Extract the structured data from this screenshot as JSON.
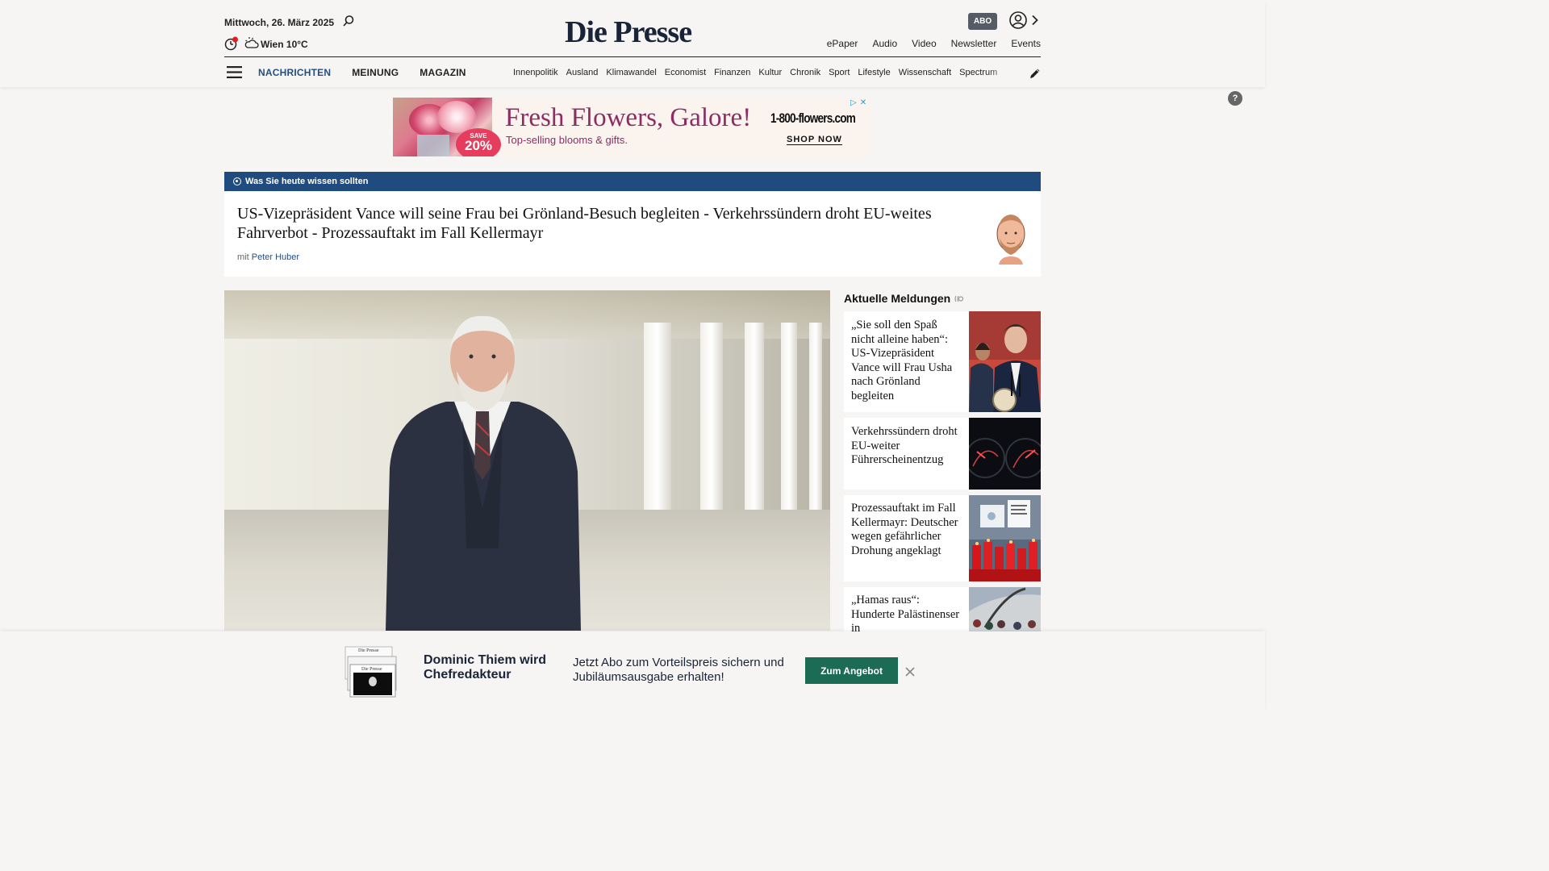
{
  "header": {
    "date": "Mittwoch, 26. März 2025",
    "weather": "Wien 10°C",
    "logo": "Die Presse",
    "abo_label": "ABO",
    "links": [
      "ePaper",
      "Audio",
      "Video",
      "Newsletter",
      "Events"
    ]
  },
  "nav": {
    "main": [
      {
        "label": "NACHRICHTEN",
        "active": true
      },
      {
        "label": "MEINUNG",
        "active": false
      },
      {
        "label": "MAGAZIN",
        "active": false
      }
    ],
    "sections": [
      "Innenpolitik",
      "Ausland",
      "Klimawandel",
      "Economist",
      "Finanzen",
      "Kultur",
      "Chronik",
      "Sport",
      "Lifestyle",
      "Wissenschaft",
      "Spectrum"
    ]
  },
  "ad": {
    "badge_top": "SAVE",
    "badge_value": "20%",
    "headline": "Fresh Flowers, Galore!",
    "subline": "Top-selling blooms & gifts.",
    "brand": "1-800-flowers.com",
    "cta": "SHOP NOW"
  },
  "briefing": {
    "label": "Was Sie heute wissen sollten",
    "title": "US-Vizepräsident Vance will seine Frau bei Grönland-Besuch begleiten - Verkehrssündern droht EU-weites Fahrverbot - Prozessauftakt im Fall Kellermayr",
    "author_prefix": "mit",
    "author": "Peter Huber"
  },
  "sidebar": {
    "title": "Aktuelle Meldungen",
    "items": [
      {
        "text": "„Sie soll den Spaß nicht alleine haben“: US-Vizepräsident Vance will Frau Usha nach Grönland begleiten"
      },
      {
        "text": "Verkehrssündern droht EU-weiter Führerscheinentzug"
      },
      {
        "text": "Prozessauftakt im Fall Kellermayr: Deutscher wegen gefährlicher Drohung angeklagt"
      },
      {
        "text": "„Hamas raus“: Hunderte Palästinenser in"
      }
    ]
  },
  "promo": {
    "title": "Dominic Thiem wird Chefredakteur",
    "text": "Jetzt Abo zum Vorteilspreis sichern und Jubiläumsausgabe erhalten!",
    "button": "Zum Angebot"
  },
  "colors": {
    "brand_blue": "#1f4b7e",
    "nav_active": "#244f81",
    "promo_green": "#1c6b55",
    "ad_magenta": "#8c2d64"
  }
}
